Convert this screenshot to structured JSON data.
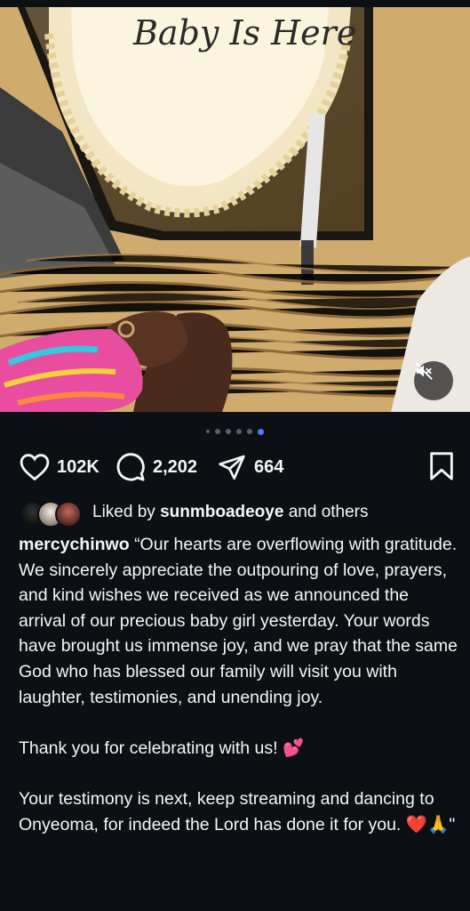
{
  "post": {
    "media": {
      "cake_text": "Baby Is Here",
      "slides_total": 6,
      "slide_active": 6,
      "muted": true
    },
    "actions": {
      "likes": "102K",
      "comments": "2,202",
      "shares": "664"
    },
    "liked_by": {
      "prefix": "Liked by",
      "user": "sunmboadeoye",
      "suffix": "and others"
    },
    "caption": {
      "username": "mercychinwo",
      "text": "“Our hearts are overflowing with gratitude.\nWe sincerely appreciate the outpouring of love, prayers, and kind wishes we received as we announced the arrival of our precious baby girl yesterday. Your words have brought us immense joy, and we pray that the same God who has blessed our family will visit you with laughter, testimonies, and unending joy.\n\nThank you for celebrating with us! 💕\n\nYour testimony is next, keep streaming and dancing to Onyeoma, for indeed the Lord has done it for you. ❤️🙏\""
    }
  },
  "icons": [
    "heart-icon",
    "comment-icon",
    "share-icon",
    "bookmark-icon",
    "volume-muted-icon"
  ],
  "colors": {
    "background": "#0c1014",
    "text": "#f5f5f5",
    "dot_active": "#4a7cf7"
  }
}
